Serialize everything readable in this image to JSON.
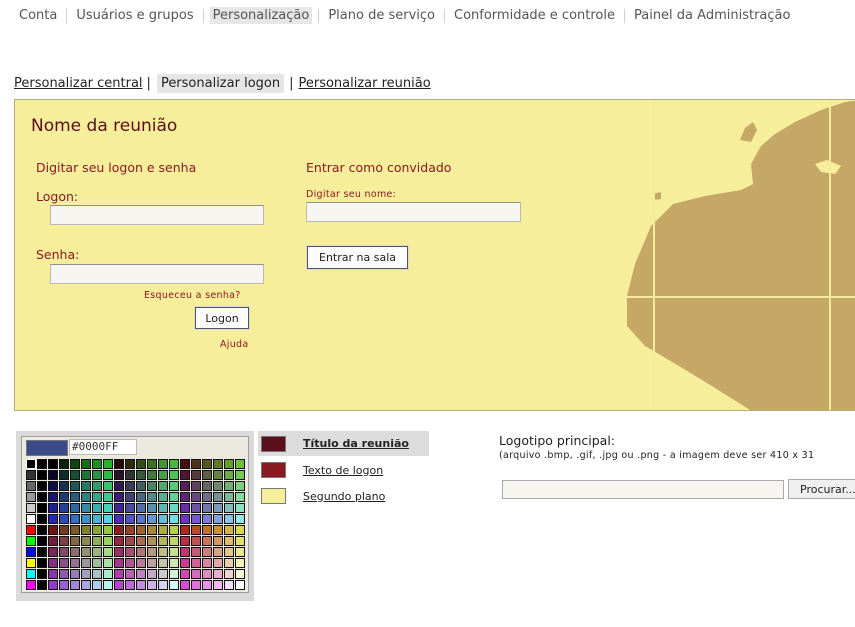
{
  "topnav": {
    "items": [
      {
        "label": "Conta"
      },
      {
        "label": "Usuários e grupos"
      },
      {
        "label": "Personalização",
        "active": true
      },
      {
        "label": "Plano de serviço"
      },
      {
        "label": "Conformidade e controle"
      },
      {
        "label": "Painel da Administração"
      }
    ]
  },
  "subnav": {
    "central": "Personalizar central",
    "logon": "Personalizar logon",
    "meeting": "Personalizar reunião",
    "separator": "|"
  },
  "preview": {
    "title": "Nome da reunião",
    "login_heading": "Digitar seu logon e senha",
    "logon_label": "Logon:",
    "logon_value": "",
    "password_label": "Senha:",
    "password_value": "",
    "forgot": "Esqueceu a senha?",
    "logon_button": "Logon",
    "help": "Ajuda",
    "guest_heading": "Entrar como convidado",
    "guest_name_label": "Digitar seu nome:",
    "guest_name_value": "",
    "enter_button": "Entrar na sala",
    "colors": {
      "background": "#F7EE9C",
      "map": "#C6A866",
      "text": "#8A1A22",
      "title": "#5A0F1A"
    }
  },
  "palette": {
    "current_hex": "#0000FF",
    "current_swatch_color": "#3B4A8A"
  },
  "color_targets": [
    {
      "label": "Título da reunião",
      "color": "#5A0F1A",
      "selected": true
    },
    {
      "label": "Texto de logon",
      "color": "#8A1A22",
      "selected": false
    },
    {
      "label": "Segundo plano",
      "color": "#F7EE9C",
      "selected": false
    }
  ],
  "logo": {
    "title": "Logotipo principal:",
    "hint": "(arquivo .bmp, .gif, .jpg ou .png - a imagem deve ser 410 x 31",
    "file_value": "",
    "browse": "Procurar..."
  }
}
